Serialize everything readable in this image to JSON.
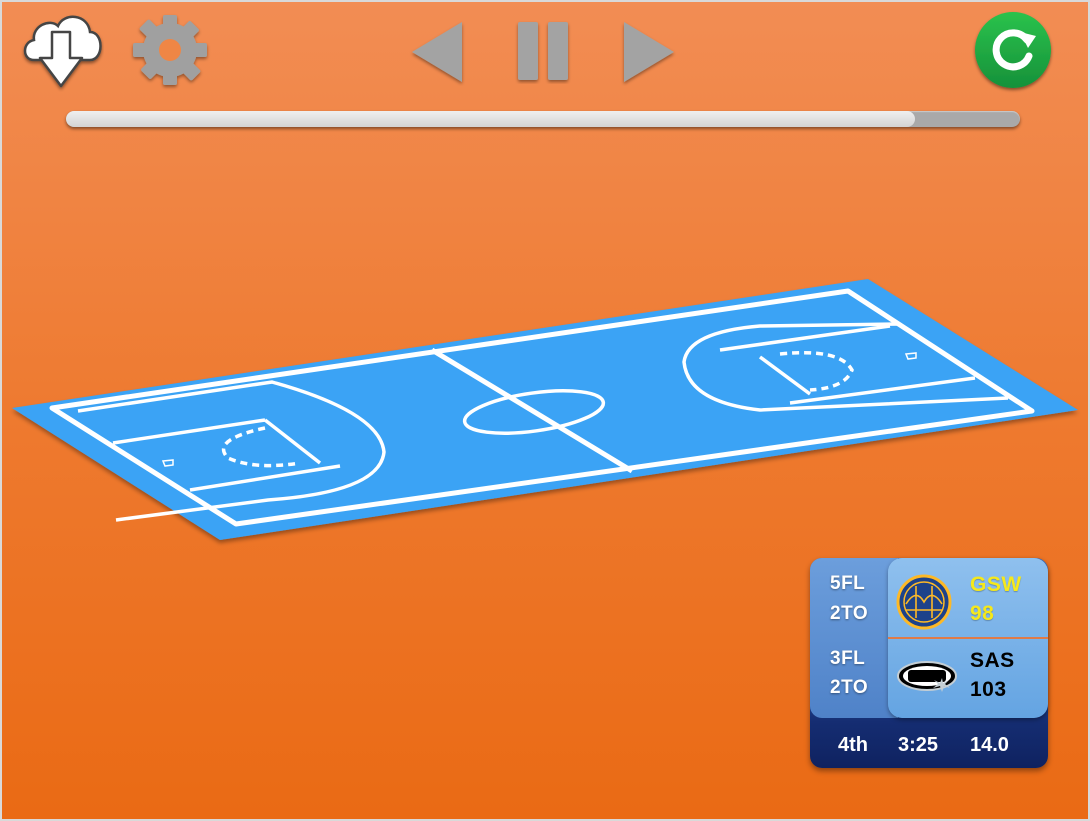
{
  "toolbar": {
    "download_icon": "cloud-download-icon",
    "settings_icon": "gear-icon",
    "prev_icon": "triangle-left-icon",
    "pause_icon": "pause-icon",
    "next_icon": "triangle-right-icon",
    "refresh_icon": "circular-arrow-icon"
  },
  "playback": {
    "progress": 0.89
  },
  "court": {
    "surface_color": "#3AA3F5",
    "line_color": "#FFFFFF"
  },
  "scoreboard": {
    "home": {
      "fouls": "5FL",
      "timeouts": "2TO",
      "abbr": "GSW",
      "score": "98",
      "color": "#F5E81C"
    },
    "away": {
      "fouls": "3FL",
      "timeouts": "2TO",
      "abbr": "SAS",
      "score": "103",
      "color": "#000000"
    },
    "period": "4th",
    "clock": "3:25",
    "shot_clock": "14.0"
  },
  "colors": {
    "background": "#EE7A30",
    "refresh": "#1FA83D",
    "controls": "#A3A3A3"
  }
}
